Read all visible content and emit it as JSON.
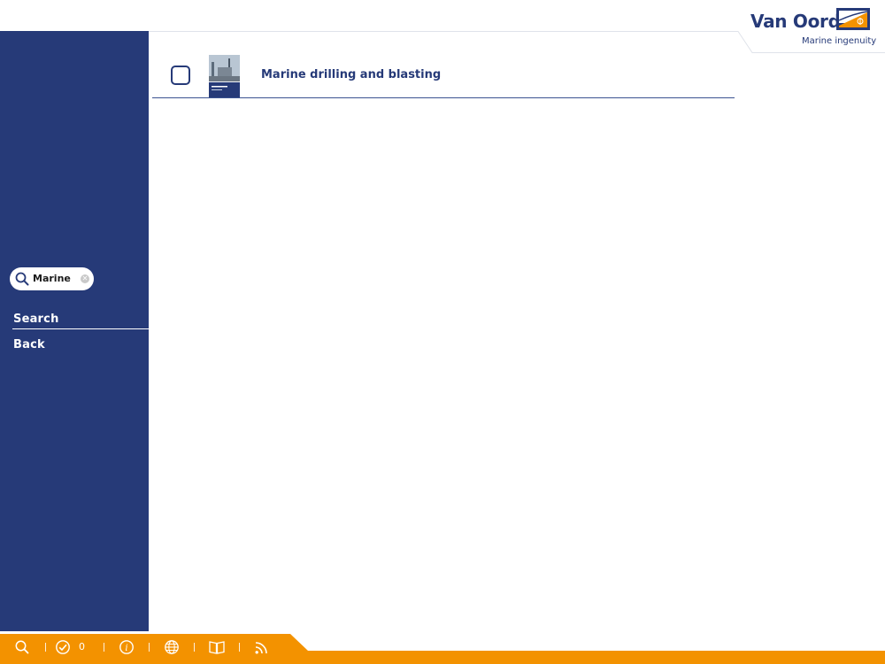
{
  "brand": {
    "name": "Van Oord",
    "tagline": "Marine ingenuity",
    "colors": {
      "navy": "#263A78",
      "orange": "#F39200"
    }
  },
  "sidebar": {
    "search_term": "Marine",
    "items": [
      {
        "label": "Search"
      },
      {
        "label": "Back"
      }
    ]
  },
  "results": [
    {
      "title": "Marine drilling and blasting",
      "checked": false
    }
  ],
  "footer": {
    "icons": [
      "search-icon",
      "check-circle-icon",
      "info-icon",
      "globe-icon",
      "book-icon",
      "rss-icon"
    ],
    "selected_count": "0"
  }
}
